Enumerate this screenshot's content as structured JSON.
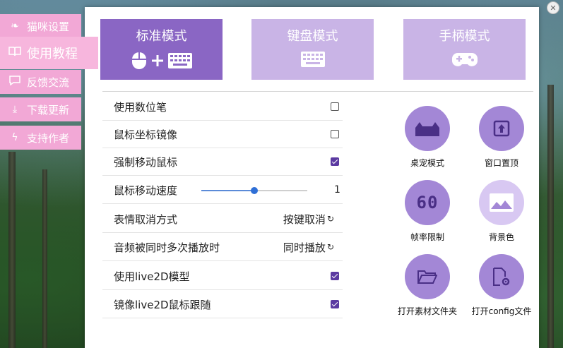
{
  "sidebar": {
    "items": [
      {
        "label": "猫咪设置",
        "icon": "paw-icon"
      },
      {
        "label": "使用教程",
        "icon": "book-icon"
      },
      {
        "label": "反馈交流",
        "icon": "chat-icon"
      },
      {
        "label": "下载更新",
        "icon": "download-icon"
      },
      {
        "label": "支持作者",
        "icon": "plug-icon"
      }
    ]
  },
  "modes": [
    {
      "label": "标准模式",
      "icon": "mouse-keyboard-icon",
      "active": true
    },
    {
      "label": "键盘模式",
      "icon": "keyboard-icon",
      "active": false
    },
    {
      "label": "手柄模式",
      "icon": "gamepad-icon",
      "active": false
    }
  ],
  "settings": {
    "use_pen": "使用数位笔",
    "mirror_mouse": "鼠标坐标镜像",
    "force_move": "强制移动鼠标",
    "mouse_speed": "鼠标移动速度",
    "mouse_speed_value": "1",
    "mouse_speed_fraction": 0.5,
    "emote_cancel": "表情取消方式",
    "emote_cancel_value": "按键取消",
    "audio_multi": "音频被同时多次播放时",
    "audio_multi_value": "同时播放",
    "use_live2d": "使用live2D模型",
    "mirror_live2d": "镜像live2D鼠标跟随"
  },
  "checks": {
    "use_pen": false,
    "mirror_mouse": false,
    "force_move": true,
    "use_live2d": true,
    "mirror_live2d": true
  },
  "actions": {
    "pet_mode": "桌宠模式",
    "window_top": "窗口置顶",
    "fps_limit": "帧率限制",
    "fps_icon_text": "60",
    "bg_color": "背景色",
    "open_assets": "打开素材文件夹",
    "open_config": "打开config文件"
  },
  "colors": {
    "accent": "#8a66c4",
    "mode_inactive": "#c9b4e6",
    "sidebar": "#f2a8d6",
    "circle": "#a387d6",
    "circle_light": "#d8c8f2",
    "checkbox_on": "#5b3aa1"
  }
}
